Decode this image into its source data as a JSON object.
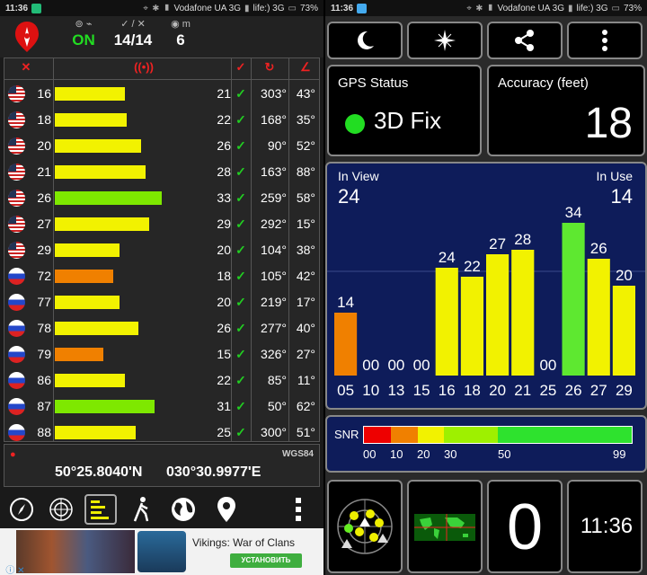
{
  "status_left": {
    "time": "11:36",
    "carrier": "Vodafone UA 3G",
    "carrier2": "life:) 3G",
    "battery": "73%"
  },
  "status_right": {
    "time": "11:36",
    "carrier": "Vodafone UA 3G",
    "carrier2": "life:) 3G",
    "battery": "73%"
  },
  "header": {
    "state": "ON",
    "fix_count": "14/14",
    "altitude": "6"
  },
  "satellites": [
    {
      "flag": "us",
      "prn": "16",
      "snr": "21",
      "azimuth": "303°",
      "elevation": "43°",
      "bar_color": "#f2f200",
      "bar_fraction": 0.52
    },
    {
      "flag": "us",
      "prn": "18",
      "snr": "22",
      "azimuth": "168°",
      "elevation": "35°",
      "bar_color": "#f2f200",
      "bar_fraction": 0.53
    },
    {
      "flag": "us",
      "prn": "20",
      "snr": "26",
      "azimuth": "90°",
      "elevation": "52°",
      "bar_color": "#f2f200",
      "bar_fraction": 0.64
    },
    {
      "flag": "us",
      "prn": "21",
      "snr": "28",
      "azimuth": "163°",
      "elevation": "88°",
      "bar_color": "#f2f200",
      "bar_fraction": 0.67
    },
    {
      "flag": "us",
      "prn": "26",
      "snr": "33",
      "azimuth": "259°",
      "elevation": "58°",
      "bar_color": "#7ee800",
      "bar_fraction": 0.79
    },
    {
      "flag": "us",
      "prn": "27",
      "snr": "29",
      "azimuth": "292°",
      "elevation": "15°",
      "bar_color": "#f2f200",
      "bar_fraction": 0.7
    },
    {
      "flag": "us",
      "prn": "29",
      "snr": "20",
      "azimuth": "104°",
      "elevation": "38°",
      "bar_color": "#f2f200",
      "bar_fraction": 0.48
    },
    {
      "flag": "ru",
      "prn": "72",
      "snr": "18",
      "azimuth": "105°",
      "elevation": "42°",
      "bar_color": "#f08000",
      "bar_fraction": 0.43
    },
    {
      "flag": "ru",
      "prn": "77",
      "snr": "20",
      "azimuth": "219°",
      "elevation": "17°",
      "bar_color": "#f2f200",
      "bar_fraction": 0.48
    },
    {
      "flag": "ru",
      "prn": "78",
      "snr": "26",
      "azimuth": "277°",
      "elevation": "40°",
      "bar_color": "#f2f200",
      "bar_fraction": 0.62
    },
    {
      "flag": "ru",
      "prn": "79",
      "snr": "15",
      "azimuth": "326°",
      "elevation": "27°",
      "bar_color": "#f08000",
      "bar_fraction": 0.36
    },
    {
      "flag": "ru",
      "prn": "86",
      "snr": "22",
      "azimuth": "85°",
      "elevation": "11°",
      "bar_color": "#f2f200",
      "bar_fraction": 0.52
    },
    {
      "flag": "ru",
      "prn": "87",
      "snr": "31",
      "azimuth": "50°",
      "elevation": "62°",
      "bar_color": "#7ee800",
      "bar_fraction": 0.74
    },
    {
      "flag": "ru",
      "prn": "88",
      "snr": "25",
      "azimuth": "300°",
      "elevation": "51°",
      "bar_color": "#f2f200",
      "bar_fraction": 0.6
    }
  ],
  "coords": {
    "datum": "WGS84",
    "lat": "50°25.8040'N",
    "lon": "030°30.9977'E"
  },
  "ad": {
    "title": "Vikings: War of Clans",
    "button": "УСТАНОВИТЬ"
  },
  "gps_status": {
    "title": "GPS Status",
    "value": "3D Fix"
  },
  "accuracy": {
    "title": "Accuracy (feet)",
    "value": "18"
  },
  "sky": {
    "in_view_label": "In View",
    "in_view": "24",
    "in_use_label": "In Use",
    "in_use": "14"
  },
  "chart_data": {
    "type": "bar",
    "categories": [
      "05",
      "10",
      "13",
      "15",
      "16",
      "18",
      "20",
      "21",
      "25",
      "26",
      "27",
      "29"
    ],
    "values": [
      14,
      0,
      0,
      0,
      24,
      22,
      27,
      28,
      0,
      34,
      26,
      20
    ],
    "labels": [
      "14",
      "00",
      "00",
      "00",
      "24",
      "22",
      "27",
      "28",
      "00",
      "34",
      "26",
      "20"
    ],
    "colors": [
      "#f08000",
      "#f2f200",
      "#f2f200",
      "#f2f200",
      "#f2f200",
      "#f2f200",
      "#f2f200",
      "#f2f200",
      "#f2f200",
      "#5ee830",
      "#f2f200",
      "#f2f200"
    ],
    "ylim": [
      0,
      40
    ]
  },
  "snr_scale": {
    "title": "SNR",
    "ticks": [
      "00",
      "10",
      "20",
      "30",
      "50",
      "99"
    ]
  },
  "clock": {
    "time": "11:36"
  },
  "counter": {
    "value": "0"
  }
}
